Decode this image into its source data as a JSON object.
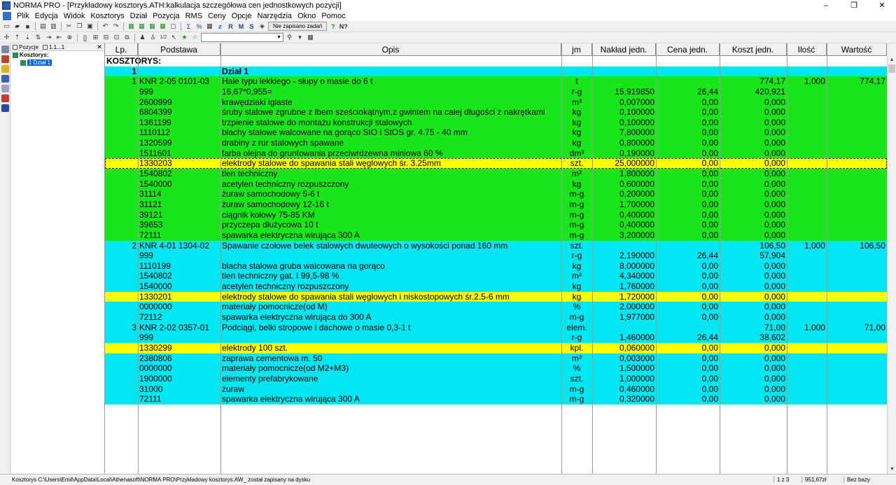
{
  "window": {
    "title": "NORMA PRO - [Przykładowy kosztorys.ATH:kalkulacja szczegółowa cen jednostkowych pozycji]",
    "min": "–",
    "max": "❐",
    "close": "✕"
  },
  "menu": [
    "Plik",
    "Edycja",
    "Widok",
    "Kosztorys",
    "Dział",
    "Pozycja",
    "RMS",
    "Ceny",
    "Opcje",
    "Narzędzia",
    "Okno",
    "Pomoc"
  ],
  "toolbar": {
    "save_status": "Nie zapisano zadań",
    "fraction": "1/2"
  },
  "tree": {
    "filter_pozycje": "Pozycje",
    "filter_range": "1.1...1",
    "close": "✕",
    "root": "Kosztorys:",
    "child": "1 Dział 1"
  },
  "columns": {
    "lp": "Lp.",
    "podstawa": "Podstawa",
    "opis": "Opis",
    "jm": "jm",
    "naklad": "Nakład jedn.",
    "cena": "Cena jedn.",
    "koszt": "Koszt jedn.",
    "ilosc": "Ilość",
    "wartosc": "Wartość"
  },
  "rows": [
    {
      "bg": "white",
      "bold": true,
      "lp": "KOSZTORYS:",
      "podstawa": "",
      "opis": "",
      "jm": "",
      "naklad": "",
      "cena": "",
      "koszt": "",
      "ilosc": "",
      "wartosc": ""
    },
    {
      "bg": "cyan",
      "bold": true,
      "lp": "1",
      "podstawa": "",
      "opis": "Dział 1",
      "jm": "",
      "naklad": "",
      "cena": "",
      "koszt": "",
      "ilosc": "",
      "wartosc": ""
    },
    {
      "bg": "green",
      "bold": false,
      "lp": "1",
      "podstawa": "KNR 2-05 0101-03",
      "opis": "Hale typu lekkiego - słupy o masie do 6 t",
      "jm": "t",
      "naklad": "",
      "cena": "",
      "koszt": "774,17",
      "ilosc": "1,000",
      "wartosc": "774,17"
    },
    {
      "bg": "green",
      "lp": "",
      "podstawa": "999",
      "opis": "16,67*0,955=",
      "jm": "r-g",
      "naklad": "15,919850",
      "cena": "26,44",
      "koszt": "420,921",
      "ilosc": "",
      "wartosc": ""
    },
    {
      "bg": "green",
      "lp": "",
      "podstawa": "2600999",
      "opis": "krawędziaki iglaste",
      "jm": "m³",
      "naklad": "0,007000",
      "cena": "0,00",
      "koszt": "0,000",
      "ilosc": "",
      "wartosc": ""
    },
    {
      "bg": "green",
      "lp": "",
      "podstawa": "6804399",
      "opis": "śruby stalowe zgrubne z łbem sześciokątnym,z gwintem na całej długości z nakrętkami",
      "jm": "kg",
      "naklad": "0,100000",
      "cena": "0,00",
      "koszt": "0,000",
      "ilosc": "",
      "wartosc": ""
    },
    {
      "bg": "green",
      "lp": "",
      "podstawa": "1361199",
      "opis": "trzpienie stalowe do montażu konstrukcji stalowych",
      "jm": "kg",
      "naklad": "0,100000",
      "cena": "0,00",
      "koszt": "0,000",
      "ilosc": "",
      "wartosc": ""
    },
    {
      "bg": "green",
      "lp": "",
      "podstawa": "1110112",
      "opis": "blachy stalowe walcowane na gorąco StO i StOS gr. 4.75 - 40 mm",
      "jm": "kg",
      "naklad": "7,800000",
      "cena": "0,00",
      "koszt": "0,000",
      "ilosc": "",
      "wartosc": ""
    },
    {
      "bg": "green",
      "lp": "",
      "podstawa": "1320599",
      "opis": "drabiny z rur stalowych spawane",
      "jm": "kg",
      "naklad": "0,800000",
      "cena": "0,00",
      "koszt": "0,000",
      "ilosc": "",
      "wartosc": ""
    },
    {
      "bg": "green",
      "lp": "",
      "podstawa": "1511601",
      "opis": "farba olejna do gruntowania przeciwrdzewna miniowa 60 %",
      "jm": "dm³",
      "naklad": "0,190000",
      "cena": "0,00",
      "koszt": "0,000",
      "ilosc": "",
      "wartosc": ""
    },
    {
      "bg": "yellow",
      "sel": true,
      "lp": "",
      "podstawa": "1330203",
      "opis": "elektrody stalowe do spawania stali węglowych śr. 3.25mm",
      "jm": "szt.",
      "naklad": "25,000000",
      "cena": "0,00",
      "koszt": "0,000",
      "ilosc": "",
      "wartosc": ""
    },
    {
      "bg": "green",
      "lp": "",
      "podstawa": "1540802",
      "opis": "tlen techniczny",
      "jm": "m³",
      "naklad": "1,800000",
      "cena": "0,00",
      "koszt": "0,000",
      "ilosc": "",
      "wartosc": ""
    },
    {
      "bg": "green",
      "lp": "",
      "podstawa": "1540000",
      "opis": "acetylen techniczny rozpuszczony",
      "jm": "kg",
      "naklad": "0,600000",
      "cena": "0,00",
      "koszt": "0,000",
      "ilosc": "",
      "wartosc": ""
    },
    {
      "bg": "green",
      "lp": "",
      "podstawa": "31114",
      "opis": "żuraw samochodowy 5-6 t",
      "jm": "m-g",
      "naklad": "0,200000",
      "cena": "0,00",
      "koszt": "0,000",
      "ilosc": "",
      "wartosc": ""
    },
    {
      "bg": "green",
      "lp": "",
      "podstawa": "31121",
      "opis": "żuraw samochodowy 12-16 t",
      "jm": "m-g",
      "naklad": "1,700000",
      "cena": "0,00",
      "koszt": "0,000",
      "ilosc": "",
      "wartosc": ""
    },
    {
      "bg": "green",
      "lp": "",
      "podstawa": "39121",
      "opis": "ciągnik kołowy 75-85 KM",
      "jm": "m-g",
      "naklad": "0,400000",
      "cena": "0,00",
      "koszt": "0,000",
      "ilosc": "",
      "wartosc": ""
    },
    {
      "bg": "green",
      "lp": "",
      "podstawa": "39653",
      "opis": "przyczepa dłużycowa 10 t",
      "jm": "m-g",
      "naklad": "0,400000",
      "cena": "0,00",
      "koszt": "0,000",
      "ilosc": "",
      "wartosc": ""
    },
    {
      "bg": "green",
      "lp": "",
      "podstawa": "72111",
      "opis": "spawarka elektryczna wirująca 300 A",
      "jm": "m-g",
      "naklad": "3,200000",
      "cena": "0,00",
      "koszt": "0,000",
      "ilosc": "",
      "wartosc": ""
    },
    {
      "bg": "cyan",
      "lp": "2",
      "podstawa": "KNR 4-01 1304-02",
      "opis": "Spawanie czołowe belek stalowych dwuteowych o wysokości ponad 160 mm",
      "jm": "szt.",
      "naklad": "",
      "cena": "",
      "koszt": "106,50",
      "ilosc": "1,000",
      "wartosc": "106,50"
    },
    {
      "bg": "cyan",
      "lp": "",
      "podstawa": "999",
      "opis": "",
      "jm": "r-g",
      "naklad": "2,190000",
      "cena": "26,44",
      "koszt": "57,904",
      "ilosc": "",
      "wartosc": ""
    },
    {
      "bg": "cyan",
      "lp": "",
      "podstawa": "1110199",
      "opis": "blacha stalowa gruba walcowana na gorąco",
      "jm": "kg",
      "naklad": "8,000000",
      "cena": "0,00",
      "koszt": "0,000",
      "ilosc": "",
      "wartosc": ""
    },
    {
      "bg": "cyan",
      "lp": "",
      "podstawa": "1540802",
      "opis": "tlen techniczny gat. I 99,5-98 %",
      "jm": "m³",
      "naklad": "4,340000",
      "cena": "0,00",
      "koszt": "0,000",
      "ilosc": "",
      "wartosc": ""
    },
    {
      "bg": "cyan",
      "lp": "",
      "podstawa": "1540000",
      "opis": "acetylen techniczny rozpuszczony",
      "jm": "kg",
      "naklad": "1,760000",
      "cena": "0,00",
      "koszt": "0,000",
      "ilosc": "",
      "wartosc": ""
    },
    {
      "bg": "yellow",
      "lp": "",
      "podstawa": "1330201",
      "opis": "elektrody stalowe do spawania stali węglowych i niskostopowych śr.2.5-6 mm",
      "jm": "kg",
      "naklad": "1,720000",
      "cena": "0,00",
      "koszt": "0,000",
      "ilosc": "",
      "wartosc": ""
    },
    {
      "bg": "cyan",
      "lp": "",
      "podstawa": "0000000",
      "opis": "materiały pomocnicze(od M)",
      "jm": "%",
      "naklad": "2,000000",
      "cena": "0,00",
      "koszt": "0,000",
      "ilosc": "",
      "wartosc": ""
    },
    {
      "bg": "cyan",
      "lp": "",
      "podstawa": "72112",
      "opis": "spawarka elektryczna wirująca do 300 A",
      "jm": "m-g",
      "naklad": "1,977000",
      "cena": "0,00",
      "koszt": "0,000",
      "ilosc": "",
      "wartosc": ""
    },
    {
      "bg": "cyan",
      "lp": "3",
      "podstawa": "KNR 2-02 0357-01",
      "opis": "Podciągi, belki stropowe i dachowe o masie 0,3-1 t",
      "jm": "elem.",
      "naklad": "",
      "cena": "",
      "koszt": "71,00",
      "ilosc": "1,000",
      "wartosc": "71,00"
    },
    {
      "bg": "cyan",
      "lp": "",
      "podstawa": "999",
      "opis": "",
      "jm": "r-g",
      "naklad": "1,460000",
      "cena": "26,44",
      "koszt": "38,602",
      "ilosc": "",
      "wartosc": ""
    },
    {
      "bg": "yellow",
      "lp": "",
      "podstawa": "1330299",
      "opis": "elektrody 100 szt.",
      "jm": "kpl.",
      "naklad": "0,060000",
      "cena": "0,00",
      "koszt": "0,000",
      "ilosc": "",
      "wartosc": ""
    },
    {
      "bg": "cyan",
      "lp": "",
      "podstawa": "2380806",
      "opis": "zaprawa cementowa m. 50",
      "jm": "m³",
      "naklad": "0,003000",
      "cena": "0,00",
      "koszt": "0,000",
      "ilosc": "",
      "wartosc": ""
    },
    {
      "bg": "cyan",
      "lp": "",
      "podstawa": "0000000",
      "opis": "materiały pomocnicze(od M2+M3)",
      "jm": "%",
      "naklad": "1,500000",
      "cena": "0,00",
      "koszt": "0,000",
      "ilosc": "",
      "wartosc": ""
    },
    {
      "bg": "cyan",
      "lp": "",
      "podstawa": "1900000",
      "opis": "elementy prefabrykowane",
      "jm": "szt.",
      "naklad": "1,000000",
      "cena": "0,00",
      "koszt": "0,000",
      "ilosc": "",
      "wartosc": ""
    },
    {
      "bg": "cyan",
      "lp": "",
      "podstawa": "31000",
      "opis": "żuraw",
      "jm": "m-g",
      "naklad": "0,460000",
      "cena": "0,00",
      "koszt": "0,000",
      "ilosc": "",
      "wartosc": ""
    },
    {
      "bg": "cyan",
      "lp": "",
      "podstawa": "72111",
      "opis": "spawarka elektryczna wirująca 300 A",
      "jm": "m-g",
      "naklad": "0,320000",
      "cena": "0,00",
      "koszt": "0,000",
      "ilosc": "",
      "wartosc": ""
    }
  ],
  "status": {
    "message": "Kosztorys C:\\Users\\Emil\\AppData\\Local\\Athenasoft\\NORMA PRO\\Przykładowy kosztorys.AW_ został zapisany na dysku",
    "page": "1 z 3",
    "total": "951,67zł",
    "base": "Bez bazy"
  },
  "colors": {
    "green": "#19e619",
    "cyan": "#00e6f0",
    "yellow": "#ffff00"
  }
}
